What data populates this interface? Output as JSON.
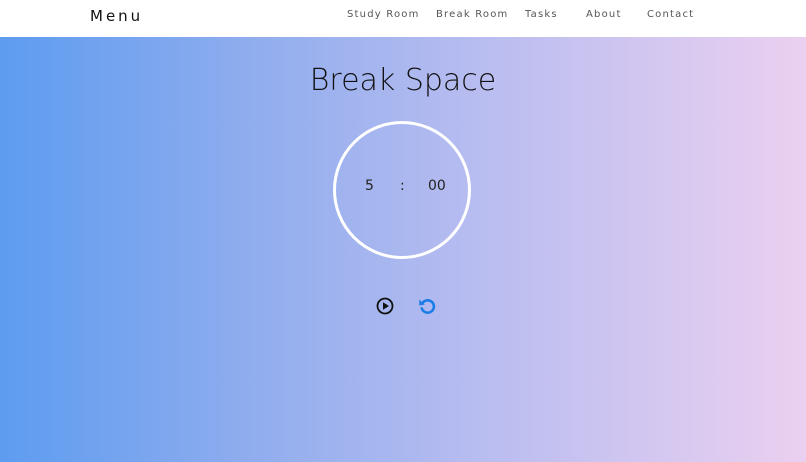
{
  "nav": {
    "brand": "Menu",
    "items": [
      "Study Room",
      "Break Room",
      "Tasks",
      "About",
      "Contact"
    ]
  },
  "page": {
    "title": "Break Space"
  },
  "timer": {
    "minutes": "5",
    "separator": ":",
    "seconds": "00"
  },
  "controls": {
    "play_icon": "play-circle-icon",
    "reset_icon": "reset-icon"
  },
  "colors": {
    "gradient_start": "#5d9cf0",
    "gradient_end": "#ebd0f0",
    "accent": "#1a7de8"
  }
}
